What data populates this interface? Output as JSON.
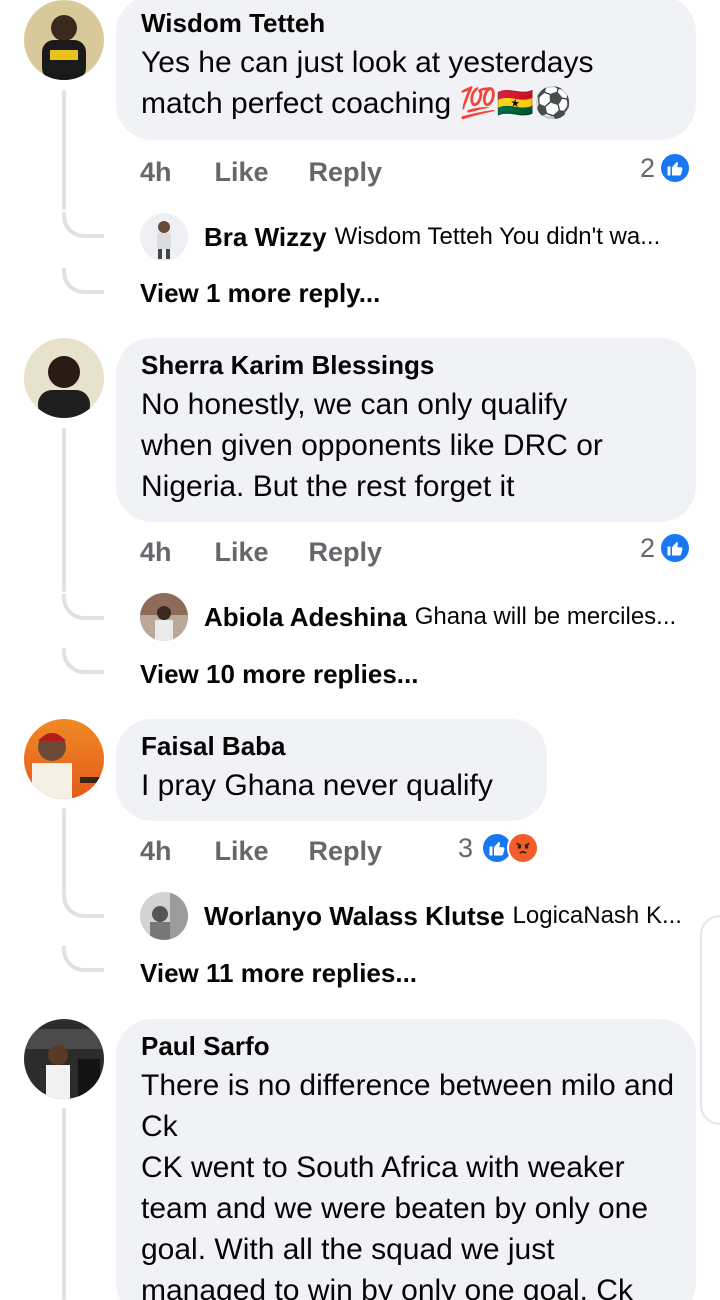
{
  "comments": [
    {
      "author": "Wisdom Tetteh",
      "text": "Yes he can just look at yesterdays match perfect coaching 💯🇬🇭⚽",
      "time": "4h",
      "like_label": "Like",
      "reply_label": "Reply",
      "reaction_count": "2",
      "reactions": [
        "like"
      ],
      "reply_preview": {
        "author": "Bra Wizzy",
        "snippet": "Wisdom Tetteh You didn't wa..."
      },
      "view_more": "View 1 more reply..."
    },
    {
      "author": "Sherra Karim Blessings",
      "text": "No honestly, we can only qualify when given opponents like DRC or Nigeria. But the rest forget it",
      "time": "4h",
      "like_label": "Like",
      "reply_label": "Reply",
      "reaction_count": "2",
      "reactions": [
        "like"
      ],
      "reply_preview": {
        "author": "Abiola Adeshina",
        "snippet": "Ghana will be merciles..."
      },
      "view_more": "View 10 more replies..."
    },
    {
      "author": "Faisal Baba",
      "text": "I pray Ghana never qualify",
      "time": "4h",
      "like_label": "Like",
      "reply_label": "Reply",
      "reaction_count": "3",
      "reactions": [
        "like",
        "angry"
      ],
      "reply_preview": {
        "author": "Worlanyo Walass Klutse",
        "snippet": "LogicaNash K..."
      },
      "view_more": "View 11 more replies..."
    },
    {
      "author": "Paul Sarfo",
      "text": "There is no difference between milo and Ck\nCK went to South Africa with weaker team and we were beaten by only one goal. With all the squad we just managed to win by only one goal. Ck"
    }
  ],
  "colors": {
    "bubble": "#f0f2f5",
    "meta_text": "#65676b",
    "like_blue": "#1877f2",
    "angry_orange": "#f25d2a",
    "thread_line": "#dfe1e5"
  },
  "icons": {
    "like_reaction": "thumbs-up-icon",
    "angry_reaction": "angry-face-icon"
  }
}
